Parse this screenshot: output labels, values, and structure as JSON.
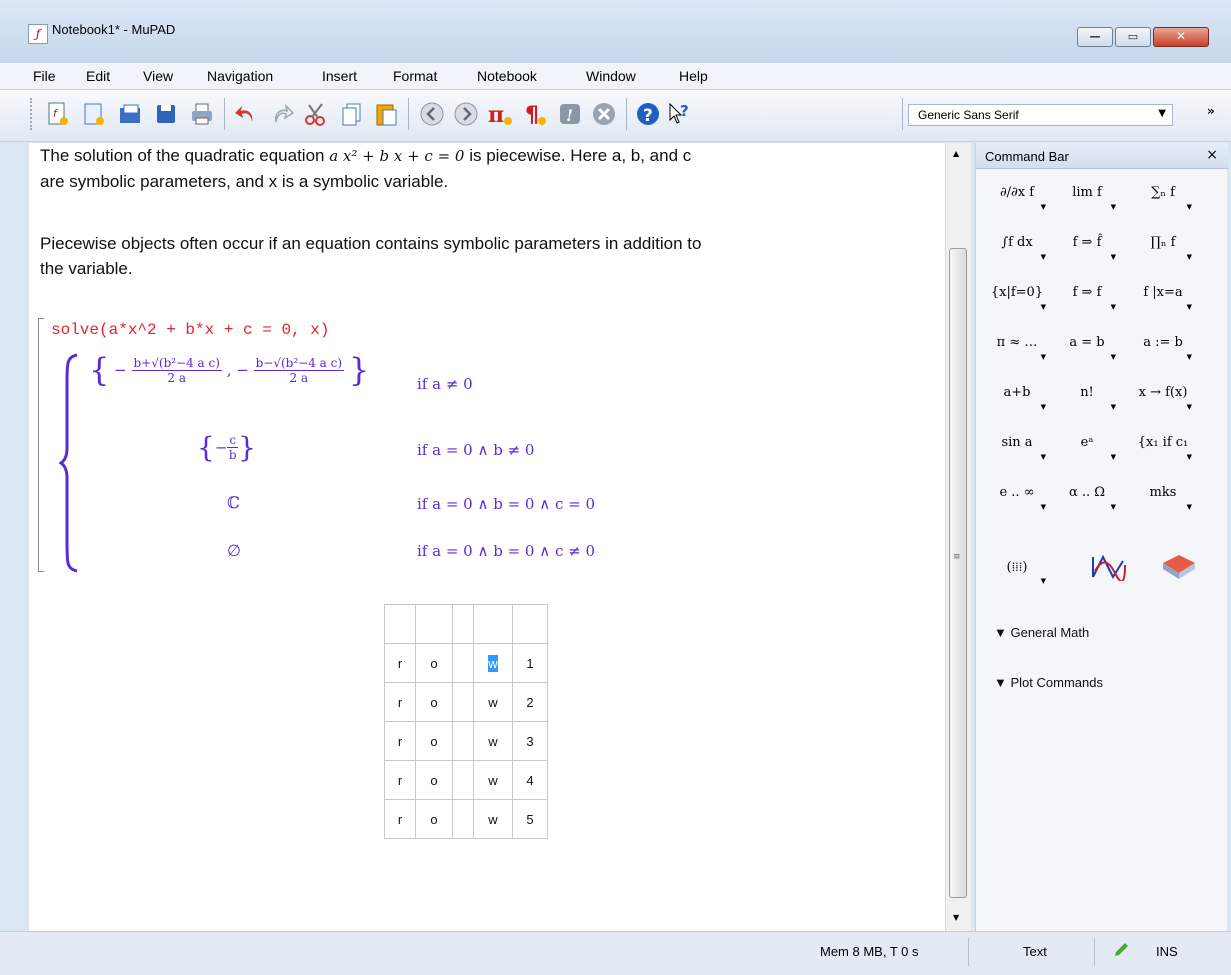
{
  "window": {
    "title": "Notebook1* - MuPAD",
    "min": "—",
    "max": "▭",
    "close": "✕"
  },
  "menu": [
    "File",
    "Edit",
    "View",
    "Navigation",
    "Insert",
    "Format",
    "Notebook",
    "Window",
    "Help"
  ],
  "toolbar": {
    "icons": [
      "new-notebook-icon",
      "new-icon",
      "open-icon",
      "save-icon",
      "print-icon",
      "undo-icon",
      "redo-icon",
      "cut-icon",
      "copy-icon",
      "paste-icon",
      "back-icon",
      "forward-icon",
      "insert-calculation-icon",
      "insert-text-icon",
      "evaluate-icon",
      "stop-icon",
      "help-icon",
      "context-help-icon"
    ],
    "font_select": "Generic Sans Serif",
    "overflow": "»"
  },
  "document": {
    "para1_a": "The solution of the quadratic equation ",
    "para1_eq": "a x² + b x + c = 0",
    "para1_b": " is piecewise. Here a, b, and c",
    "para1_line2": "are symbolic parameters, and x is a symbolic variable.",
    "para2_line1": "Piecewise objects often occur if an equation contains symbolic parameters in addition to",
    "para2_line2": "the variable.",
    "input": "solve(a*x^2 + b*x + c = 0, x)",
    "output": {
      "case1_num1": "b+√(b²−4 a c)",
      "case1_den": "2 a",
      "case1_num2": "b−√(b²−4 a c)",
      "case1_cond": "if  a ≠ 0",
      "case2_num": "c",
      "case2_den": "b",
      "case2_cond": "if  a = 0 ∧ b ≠ 0",
      "case3_val": "ℂ",
      "case3_cond": "if  a = 0 ∧ b = 0 ∧ c = 0",
      "case4_val": "∅",
      "case4_cond": "if  a = 0 ∧ b = 0 ∧ c ≠ 0"
    },
    "table": {
      "header": [
        "",
        "",
        "",
        "",
        ""
      ],
      "rows": [
        [
          "r",
          "o",
          "",
          "w",
          "1"
        ],
        [
          "r",
          "o",
          "",
          "w",
          "2"
        ],
        [
          "r",
          "o",
          "",
          "w",
          "3"
        ],
        [
          "r",
          "o",
          "",
          "w",
          "4"
        ],
        [
          "r",
          "o",
          "",
          "w",
          "5"
        ]
      ]
    }
  },
  "command_bar": {
    "title": "Command Bar",
    "close": "×",
    "buttons": [
      [
        "∂/∂x f",
        "lim f",
        "∑ₙ f"
      ],
      [
        "∫f dx",
        "f ⇒ f̂",
        "∏ₙ f"
      ],
      [
        "{x|f=0}",
        "f ⇒ f",
        "f |x=a"
      ],
      [
        "π ≈ …",
        "a = b",
        "a := b"
      ],
      [
        "a+b",
        "n!",
        "x → f(x)"
      ],
      [
        "sin a",
        "eᵃ",
        "{x₁ if c₁"
      ],
      [
        "e .. ∞",
        "α .. Ω",
        "mks"
      ],
      [
        "(⁞⁞⁞)",
        "",
        ""
      ]
    ],
    "sections": [
      "General Math",
      "Plot Commands"
    ]
  },
  "status": {
    "mem": "Mem 8 MB, T 0 s",
    "mode": "Text",
    "ins": "INS"
  }
}
